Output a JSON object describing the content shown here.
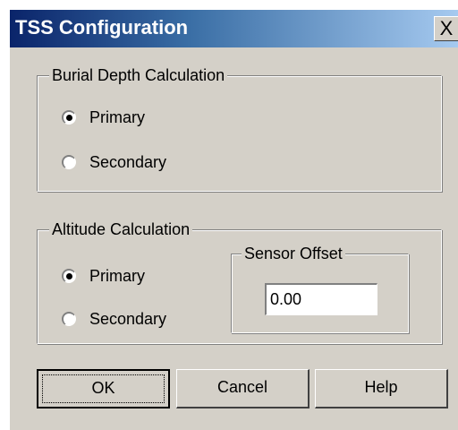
{
  "window": {
    "title": "TSS Configuration",
    "close_label": "X",
    "colors": {
      "face": "#d4d0c8",
      "title_start": "#0a246a",
      "title_end": "#a6caf0",
      "title_text": "#ffffff"
    }
  },
  "burial_group": {
    "label": "Burial Depth Calculation",
    "options": [
      {
        "label": "Primary",
        "selected": true
      },
      {
        "label": "Secondary",
        "selected": false
      }
    ]
  },
  "altitude_group": {
    "label": "Altitude Calculation",
    "options": [
      {
        "label": "Primary",
        "selected": true
      },
      {
        "label": "Secondary",
        "selected": false
      }
    ],
    "sensor_offset": {
      "label": "Sensor Offset",
      "value": "0.00"
    }
  },
  "buttons": {
    "ok": "OK",
    "cancel": "Cancel",
    "help": "Help"
  }
}
